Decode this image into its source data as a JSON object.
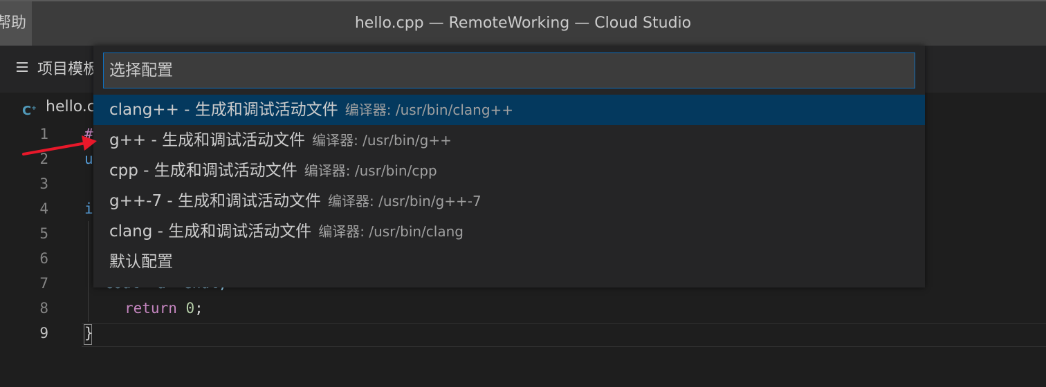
{
  "titlebar": {
    "menu_partial": "帮助",
    "window_title": "hello.cpp — RemoteWorking — Cloud Studio"
  },
  "panel": {
    "title_partial": "项目模板"
  },
  "tab": {
    "label_partial": "hello.cpp",
    "icon": "cpp-file-icon"
  },
  "editor": {
    "line_numbers": [
      "1",
      "2",
      "3",
      "4",
      "5",
      "6",
      "7",
      "8",
      "9"
    ],
    "visible_code": {
      "line1": "#",
      "line2": "u",
      "line4": "i",
      "line7": "  cout<<a<<endl;",
      "line8_keyword": "return",
      "line8_value": "0",
      "line8_end": ";",
      "line9": "}"
    }
  },
  "quickpick": {
    "placeholder": "选择配置",
    "items": [
      {
        "label": "clang++ - 生成和调试活动文件",
        "description": "编译器: /usr/bin/clang++",
        "selected": true
      },
      {
        "label": "g++ - 生成和调试活动文件",
        "description": "编译器: /usr/bin/g++"
      },
      {
        "label": "cpp - 生成和调试活动文件",
        "description": "编译器: /usr/bin/cpp"
      },
      {
        "label": "g++-7 - 生成和调试活动文件",
        "description": "编译器: /usr/bin/g++-7"
      },
      {
        "label": "clang - 生成和调试活动文件",
        "description": "编译器: /usr/bin/clang"
      },
      {
        "label": "默认配置",
        "description": ""
      }
    ]
  },
  "colors": {
    "selection": "#04395e",
    "input_border": "#0e70c0",
    "annotation_arrow": "#e8182a"
  }
}
